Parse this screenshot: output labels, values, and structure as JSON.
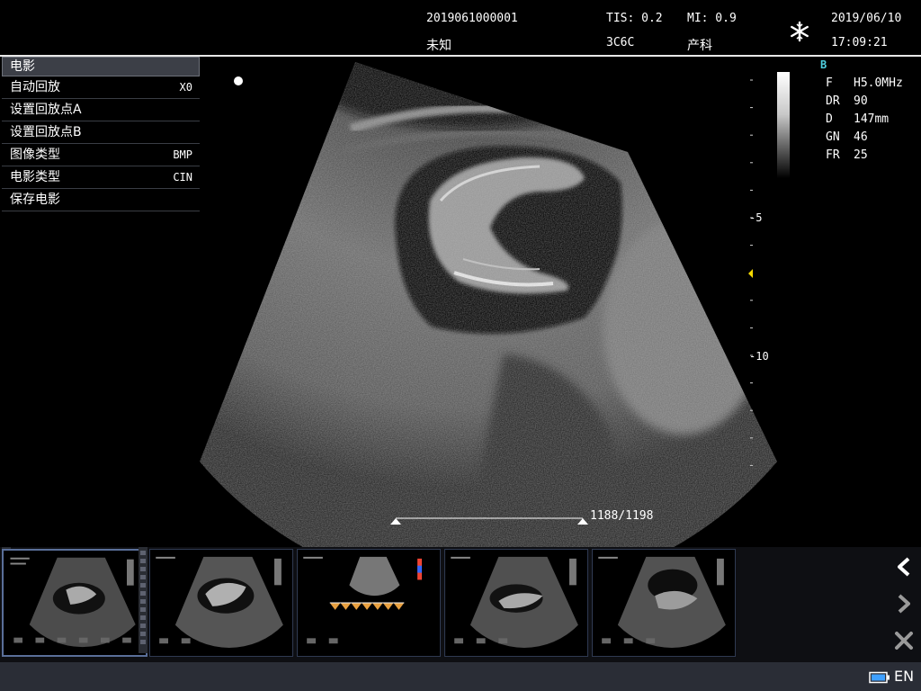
{
  "header": {
    "patient_id": "2019061000001",
    "patient_name": "未知",
    "tis": "TIS: 0.2",
    "probe": "3C6C",
    "mi": "MI: 0.9",
    "exam": "产科",
    "date": "2019/06/10",
    "time": "17:09:21",
    "freeze_icon": "snowflake-icon"
  },
  "menu": {
    "title": "电影",
    "items": [
      {
        "label": "自动回放",
        "value": "X0"
      },
      {
        "label": "设置回放点A",
        "value": ""
      },
      {
        "label": "设置回放点B",
        "value": ""
      },
      {
        "label": "图像类型",
        "value": "BMP"
      },
      {
        "label": "电影类型",
        "value": "CIN"
      },
      {
        "label": "保存电影",
        "value": ""
      }
    ]
  },
  "params": {
    "mode": "B",
    "rows": [
      {
        "key": "F",
        "value": "H5.0MHz"
      },
      {
        "key": "DR",
        "value": "90"
      },
      {
        "key": "D",
        "value": "147mm"
      },
      {
        "key": "GN",
        "value": "46"
      },
      {
        "key": "FR",
        "value": "25"
      }
    ]
  },
  "depth_scale": {
    "labels": [
      "-5",
      "-10"
    ]
  },
  "cine": {
    "counter": "1188/1198",
    "current": 1188,
    "total": 1198
  },
  "thumbnails": [
    {
      "kind": "fetal",
      "selected": true
    },
    {
      "kind": "fetal",
      "selected": false
    },
    {
      "kind": "doppler",
      "selected": false
    },
    {
      "kind": "fetal",
      "selected": false
    },
    {
      "kind": "fetal",
      "selected": false
    }
  ],
  "nav": {
    "prev_icon": "chevron-left-icon",
    "next_icon": "chevron-right-icon",
    "delete_icon": "close-icon"
  },
  "status": {
    "language": "EN",
    "battery_icon": "battery-icon"
  },
  "colors": {
    "background": "#000000",
    "menu_title_bg": "#3c3f47",
    "mode_label": "#4fd0e0",
    "focus_marker": "#f5d800",
    "status_bar": "#2a2d36"
  }
}
